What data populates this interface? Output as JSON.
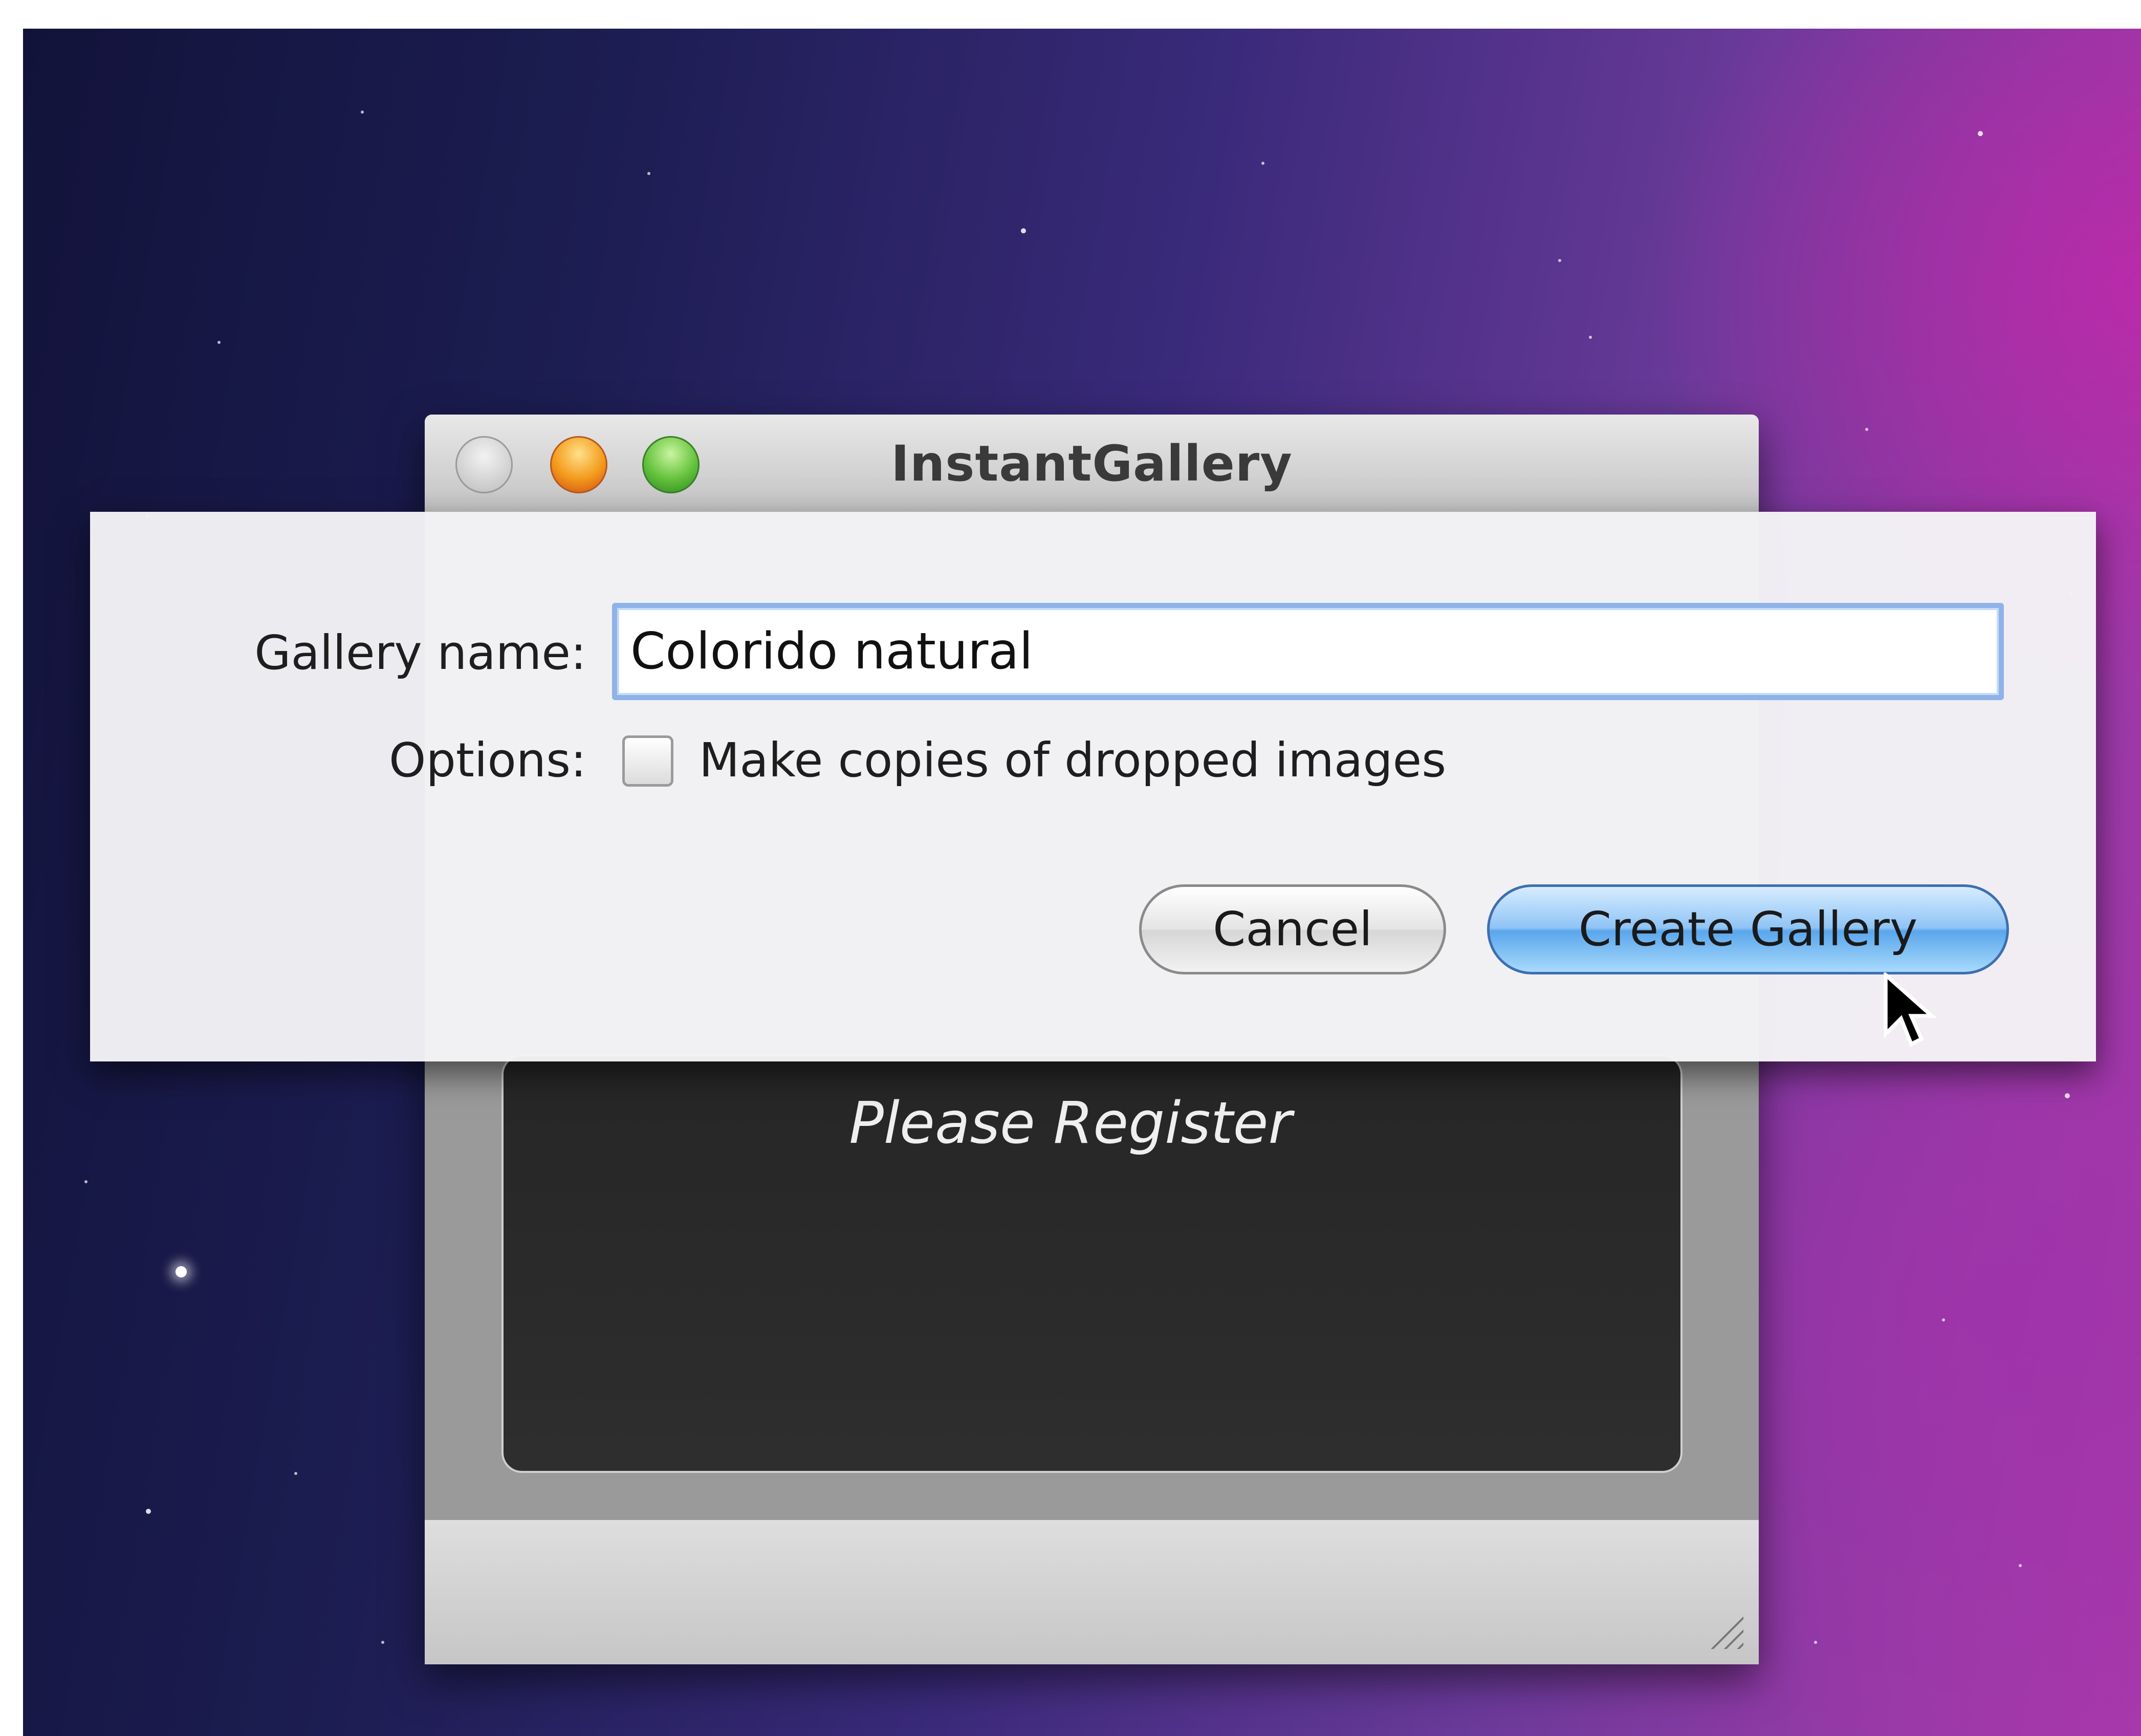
{
  "window": {
    "title": "InstantGallery",
    "register_text": "Please Register"
  },
  "sheet": {
    "gallery_name_label": "Gallery name:",
    "gallery_name_value": "Colorido natural",
    "options_label": "Options:",
    "copy_option_label": "Make copies of dropped images",
    "copy_option_checked": false,
    "cancel_label": "Cancel",
    "create_label": "Create Gallery"
  },
  "icons": {
    "close": "close-icon",
    "minimize": "minimize-icon",
    "zoom": "zoom-icon",
    "resize": "resize-grip-icon",
    "cursor": "mouse-pointer-icon"
  },
  "colors": {
    "default_button": "#5aa6ec",
    "focus_ring": "#8fb3e8",
    "desktop_purple": "#a938ac",
    "desktop_navy": "#1c1d52"
  }
}
